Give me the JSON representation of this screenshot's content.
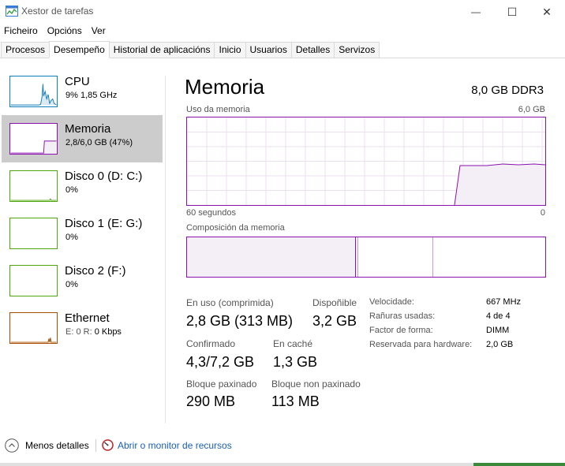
{
  "window": {
    "title": "Xestor de tarefas",
    "minimize_glyph": "—",
    "maximize_glyph": "☐",
    "close_glyph": "✕"
  },
  "menu": [
    "Ficheiro",
    "Opcións",
    "Ver"
  ],
  "tabs": [
    "Procesos",
    "Desempeño",
    "Historial de aplicacións",
    "Inicio",
    "Usuarios",
    "Detalles",
    "Servizos"
  ],
  "active_tab": "Desempeño",
  "sidebar": {
    "items": [
      {
        "title": "CPU",
        "subtitle": "9% 1,85 GHz",
        "color": "#117dbb",
        "selected": false
      },
      {
        "title": "Memoria",
        "subtitle": "2,8/6,0 GB (47%)",
        "color": "#8b12ae",
        "selected": true
      },
      {
        "title": "Disco 0 (D: C:)",
        "subtitle": "0%",
        "color": "#4da60c",
        "selected": false
      },
      {
        "title": "Disco 1 (E: G:)",
        "subtitle": "0%",
        "color": "#4da60c",
        "selected": false
      },
      {
        "title": "Disco 2 (F:)",
        "subtitle": "0%",
        "color": "#4da60c",
        "selected": false
      },
      {
        "title": "Ethernet",
        "subtitle_prefix": "E: 0 R: ",
        "subtitle_bold": "0 Kbps",
        "color": "#a74f01",
        "selected": false
      }
    ]
  },
  "main": {
    "title": "Memoria",
    "spec": "8,0 GB DDR3",
    "usage_label": "Uso da memoria",
    "usage_max": "6,0 GB",
    "time_left": "60 segundos",
    "time_right": "0",
    "composition_label": "Composición da memoria",
    "usage_percent": 47,
    "stats": {
      "in_use_label": "En uso (comprimida)",
      "in_use_value": "2,8 GB (313 MB)",
      "available_label": "Dispoñible",
      "available_value": "3,2 GB",
      "committed_label": "Confirmado",
      "committed_value": "4,3/7,2 GB",
      "cached_label": "En caché",
      "cached_value": "1,3 GB",
      "paged_label": "Bloque paxinado",
      "paged_value": "290 MB",
      "nonpaged_label": "Bloque non paxinado",
      "nonpaged_value": "113 MB"
    },
    "props": {
      "speed_label": "Velocidade:",
      "speed_value": "667 MHz",
      "slots_label": "Rañuras usadas:",
      "slots_value": "4 de 4",
      "form_label": "Factor de forma:",
      "form_value": "DIMM",
      "reserved_label": "Reservada para hardware:",
      "reserved_value": "2,0 GB"
    }
  },
  "footer": {
    "less_details": "Menos detalles",
    "resource_monitor": "Abrir o monitor de recursos"
  },
  "colors": {
    "memory": "#8b12ae",
    "cpu": "#117dbb",
    "disk": "#4da60c",
    "ethernet": "#a74f01",
    "link": "#1a5fb4"
  }
}
